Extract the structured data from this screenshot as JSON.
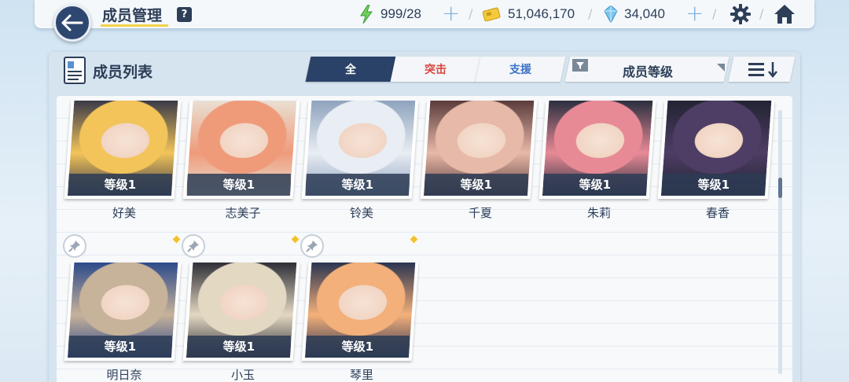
{
  "header": {
    "title": "成员管理",
    "help": "?",
    "stamina": "999/28",
    "credits": "51,046,170",
    "gems": "34,040"
  },
  "panel": {
    "title": "成员列表",
    "tabs": [
      "全",
      "突击",
      "支援"
    ],
    "sort_label": "成员等级"
  },
  "members": [
    {
      "name": "好美",
      "level": "等级1",
      "colors": [
        "#f2c45a",
        "#3a3a48"
      ]
    },
    {
      "name": "志美子",
      "level": "等级1",
      "colors": [
        "#ef9b7a",
        "#e9e0d4"
      ]
    },
    {
      "name": "铃美",
      "level": "等级1",
      "colors": [
        "#e9edf4",
        "#8ea3bd"
      ]
    },
    {
      "name": "千夏",
      "level": "等级1",
      "colors": [
        "#e7b9a8",
        "#5a3b3b"
      ]
    },
    {
      "name": "朱莉",
      "level": "等级1",
      "colors": [
        "#e88a96",
        "#2a2f3f"
      ]
    },
    {
      "name": "春香",
      "level": "等级1",
      "colors": [
        "#4e3d64",
        "#222433"
      ]
    },
    {
      "name": "明日奈",
      "level": "等级1",
      "colors": [
        "#c7b29a",
        "#2d4a8a"
      ]
    },
    {
      "name": "小玉",
      "level": "等级1",
      "colors": [
        "#e3d8c2",
        "#2e2e36"
      ]
    },
    {
      "name": "琴里",
      "level": "等级1",
      "colors": [
        "#f4b07a",
        "#2a3450"
      ]
    }
  ]
}
